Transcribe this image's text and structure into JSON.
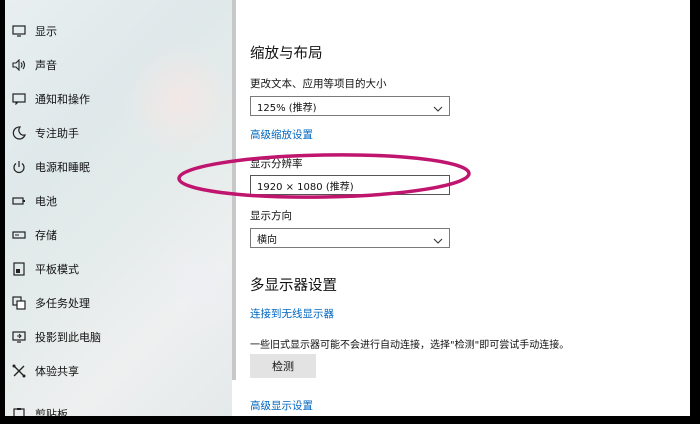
{
  "sidebar": {
    "items": [
      {
        "label": "显示",
        "icon": "monitor-icon"
      },
      {
        "label": "声音",
        "icon": "speaker-icon"
      },
      {
        "label": "通知和操作",
        "icon": "notification-icon"
      },
      {
        "label": "专注助手",
        "icon": "moon-icon"
      },
      {
        "label": "电源和睡眠",
        "icon": "power-icon"
      },
      {
        "label": "电池",
        "icon": "battery-icon"
      },
      {
        "label": "存储",
        "icon": "storage-icon"
      },
      {
        "label": "平板模式",
        "icon": "tablet-icon"
      },
      {
        "label": "多任务处理",
        "icon": "multitask-icon"
      },
      {
        "label": "投影到此电脑",
        "icon": "project-icon"
      },
      {
        "label": "体验共享",
        "icon": "share-icon"
      },
      {
        "label": "剪贴板",
        "icon": "clipboard-icon"
      }
    ]
  },
  "main": {
    "scale_section": {
      "title": "缩放与布局",
      "text_size_label": "更改文本、应用等项目的大小",
      "text_size_value": "125% (推荐)",
      "advanced_scaling_link": "高级缩放设置",
      "resolution_label": "显示分辨率",
      "resolution_value": "1920 × 1080 (推荐)",
      "orientation_label": "显示方向",
      "orientation_value": "横向"
    },
    "multi_display": {
      "title": "多显示器设置",
      "wireless_link": "连接到无线显示器",
      "info_text": "一些旧式显示器可能不会进行自动连接，选择\"检测\"即可尝试手动连接。",
      "detect_button": "检测",
      "advanced_display_link": "高级显示设置"
    }
  },
  "colors": {
    "accent": "#0067c0",
    "annotation": "#c0156f"
  }
}
